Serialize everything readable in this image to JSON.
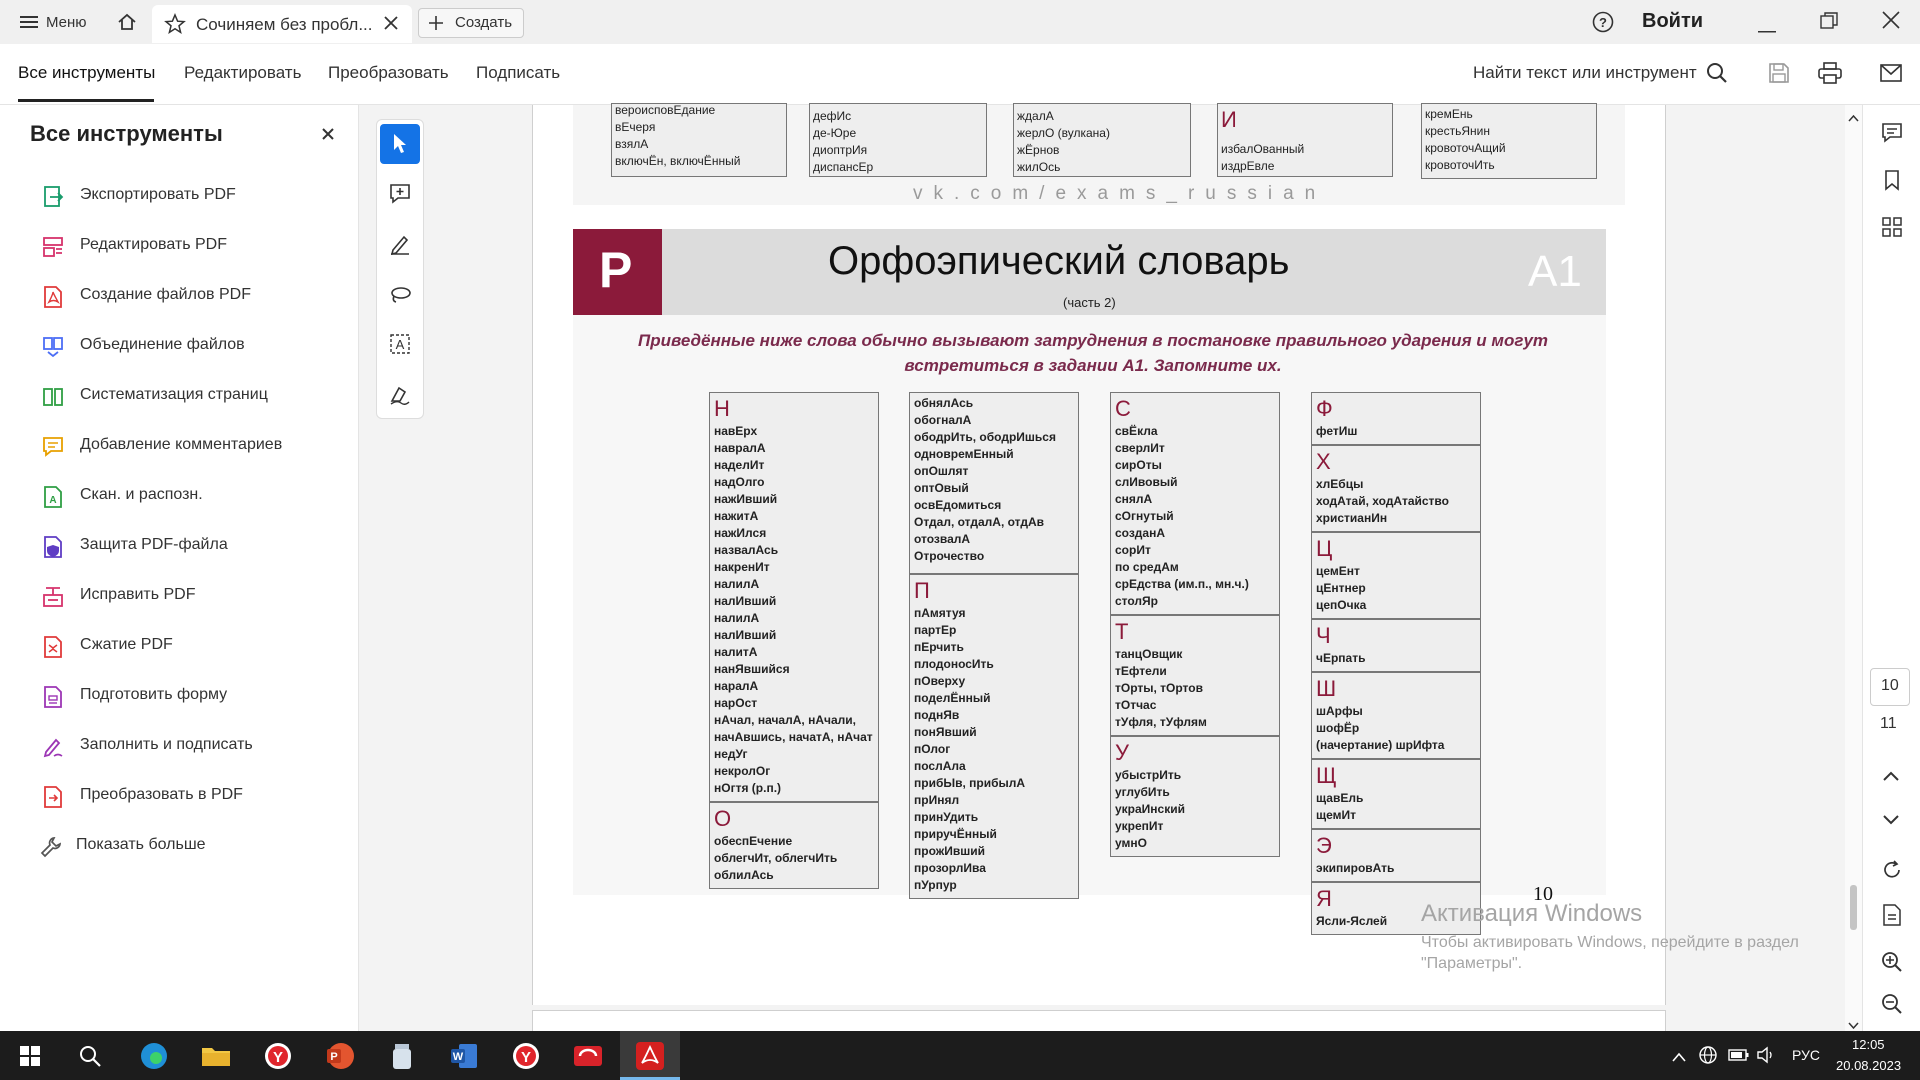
{
  "titlebar": {
    "menu_label": "Меню",
    "tab_title": "Сочиняем без пробл...",
    "create_label": "Создать",
    "signin_label": "Войти"
  },
  "menubar": {
    "items": [
      "Все инструменты",
      "Редактировать",
      "Преобразовать",
      "Подписать"
    ],
    "search_label": "Найти текст или инструмент"
  },
  "leftpanel": {
    "title": "Все инструменты",
    "tools": [
      {
        "label": "Экспортировать PDF",
        "icon": "export-pdf-icon",
        "color": "#1a9c6c"
      },
      {
        "label": "Редактировать PDF",
        "icon": "edit-pdf-icon",
        "color": "#d6336c"
      },
      {
        "label": "Создание файлов PDF",
        "icon": "create-pdf-icon",
        "color": "#e03a3a"
      },
      {
        "label": "Объединение файлов",
        "icon": "combine-files-icon",
        "color": "#4c6ef5"
      },
      {
        "label": "Систематизация страниц",
        "icon": "organize-pages-icon",
        "color": "#2f9e44"
      },
      {
        "label": "Добавление комментариев",
        "icon": "comment-icon",
        "color": "#e8a000"
      },
      {
        "label": "Скан. и распозн.",
        "icon": "scan-ocr-icon",
        "color": "#2f9e44"
      },
      {
        "label": "Защита PDF-файла",
        "icon": "protect-pdf-icon",
        "color": "#5f3dc4"
      },
      {
        "label": "Исправить PDF",
        "icon": "redact-pdf-icon",
        "color": "#d6336c"
      },
      {
        "label": "Сжатие PDF",
        "icon": "compress-pdf-icon",
        "color": "#e03a3a"
      },
      {
        "label": "Подготовить форму",
        "icon": "prepare-form-icon",
        "color": "#9c36b5"
      },
      {
        "label": "Заполнить и подписать",
        "icon": "fill-sign-icon",
        "color": "#9c36b5"
      },
      {
        "label": "Преобразовать в PDF",
        "icon": "convert-pdf-icon",
        "color": "#e03a3a"
      },
      {
        "label": "Показать больше",
        "icon": "wrench-icon",
        "color": "#555555"
      }
    ]
  },
  "document": {
    "top_cards": [
      [
        "вероисповЕдание",
        "вЕчеря",
        "взялА",
        "включЁн, включЁнный"
      ],
      [
        "дефИс",
        "де-Юре",
        "диоптрИя",
        "диспансЕр"
      ],
      [
        "ждалА",
        "жерлО (вулкана)",
        "жЁрнов",
        "жилОсь"
      ],
      [
        "И",
        "избалОванный",
        "издрЕвле"
      ],
      [
        "кремЕнь",
        "крестьЯнин",
        "кровоточАщий",
        "кровоточИть"
      ]
    ],
    "watermark": "vk.com/exams_russian",
    "header_letter": "Р",
    "header_title": "Орфоэпический словарь",
    "header_subtitle": "(часть 2)",
    "header_code": "А1",
    "intro": "Приведённые ниже слова обычно вызывают затруднения в постановке правильного ударения и могут встретиться в задании А1. Запомните их.",
    "page_number": "10",
    "col1": [
      {
        "letter": "Н",
        "words": [
          "навЕрх",
          "навралА",
          "наделИт",
          "надОлго",
          "нажИвший",
          "нажитА",
          "нажИлся",
          "назвалАсь",
          "накренИт",
          "налилА",
          "налИвший",
          "налилА",
          "налИвший",
          "налитА",
          "нанЯвшийся",
          "наралА",
          "нарОст",
          "нАчал, началА, нАчали,",
          "начАвшись, начатА, нАчат",
          "недУг",
          "некролОг",
          "нОгтя (р.п.)"
        ]
      },
      {
        "letter": "О",
        "words": [
          "обеспЕчение",
          "облегчИт, облегчИть",
          "облилАсь"
        ]
      }
    ],
    "col2": [
      {
        "letter": "",
        "words": [
          "обнялАсь",
          "обогналА",
          "ободрИть, ободрИшься",
          "одновремЕнный",
          "опОшлят",
          "оптОвый",
          "освЕдомиться",
          "Отдал, отдалА, отдАв",
          "отозвалА",
          "Отрочество"
        ]
      },
      {
        "letter": "П",
        "words": [
          "пАмятуя",
          "партЕр",
          "пЕрчить",
          "плодоносИть",
          "пОверху",
          "поделЁнный",
          "поднЯв",
          "понЯвший",
          "пОлог",
          "послАла",
          "прибЫв, прибылА",
          "прИнял",
          "принУдить",
          "приручЁнный",
          "прожИвший",
          "прозорлИва",
          "пУрпур"
        ]
      }
    ],
    "col3": [
      {
        "letter": "С",
        "words": [
          "свЁкла",
          "сверлИт",
          "сирОты",
          "слИвовый",
          "снялА",
          "сОгнутый",
          "созданА",
          "сорИт",
          "по средАм",
          "срЕдства (им.п., мн.ч.)",
          "столЯр"
        ]
      },
      {
        "letter": "Т",
        "words": [
          "танцОвщик",
          "тЕфтели",
          "тОрты, тОртов",
          "тОтчас",
          "тУфля, тУфлям"
        ]
      },
      {
        "letter": "У",
        "words": [
          "убыстрИть",
          "углубИть",
          "украИнский",
          "укрепИт",
          "умнО"
        ]
      }
    ],
    "col4": [
      {
        "letter": "Ф",
        "words": [
          "фетИш"
        ]
      },
      {
        "letter": "Х",
        "words": [
          "хлЕбцы",
          "ходАтай, ходАтайство",
          "христианИн"
        ]
      },
      {
        "letter": "Ц",
        "words": [
          "цемЕнт",
          "цЕнтнер",
          "цепОчка"
        ]
      },
      {
        "letter": "Ч",
        "words": [
          "чЕрпать"
        ]
      },
      {
        "letter": "Ш",
        "words": [
          "шАрфы",
          "шофЁр",
          "(начертание) шрИфта"
        ]
      },
      {
        "letter": "Щ",
        "words": [
          "щавЕль",
          "щемИт"
        ]
      },
      {
        "letter": "Э",
        "words": [
          "экипировАть"
        ]
      },
      {
        "letter": "Я",
        "words": [
          "Ясли-Яслей"
        ]
      }
    ]
  },
  "activation": {
    "title": "Активация Windows",
    "line1": "Чтобы активировать Windows, перейдите в раздел",
    "line2": "\"Параметры\"."
  },
  "rightrail": {
    "page_current": "10",
    "page_total": "11"
  },
  "taskbar": {
    "lang": "РУС",
    "time": "12:05",
    "date": "20.08.2023"
  },
  "colors": {
    "accent": "#1473e6",
    "brand_red": "#8b1a3a",
    "taskbar": "#1c1c1c"
  }
}
